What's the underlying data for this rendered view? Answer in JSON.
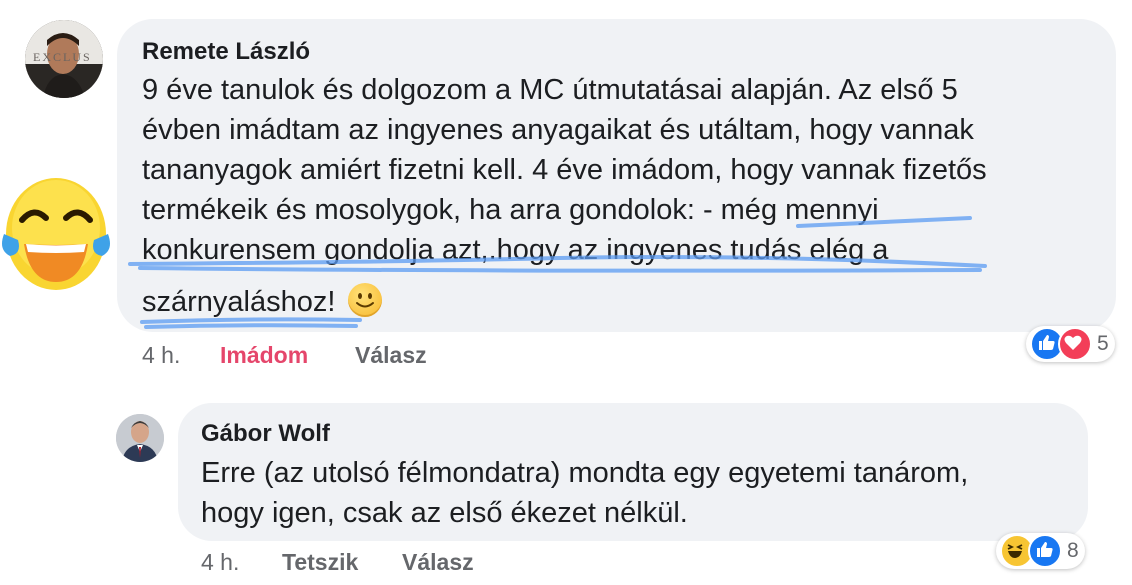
{
  "comments": [
    {
      "author": "Remete László",
      "lines": [
        "9 éve tanulok és dolgozom a MC útmutatásai alapján. Az első 5",
        "évben imádtam az ingyenes anyagaikat és utáltam, hogy vannak",
        "tananyagok amiért fizetni kell. 4 éve imádom, hogy vannak fizetős",
        "termékeik és mosolygok, ha arra gondolok: - még mennyi",
        "konkurensem gondolja azt,.hogy az ingyenes tudás elég a",
        "szárnyaláshoz!"
      ],
      "time": "4 h.",
      "reaction_label": "Imádom",
      "reply_label": "Válasz",
      "reaction_count": "5",
      "reaction_types": [
        "like-icon",
        "love-icon"
      ]
    },
    {
      "author": "Gábor Wolf",
      "lines": [
        "Erre (az utolsó félmondatra) mondta egy egyetemi tanárom,",
        "hogy igen, csak az első ékezet nélkül."
      ],
      "time": "4 h.",
      "reaction_label": "Tetszik",
      "reply_label": "Válasz",
      "reaction_count": "8",
      "reaction_types": [
        "haha-icon",
        "like-icon"
      ]
    }
  ],
  "avatar_1_logo_text": "EXCLUS",
  "colors": {
    "bubble": "#f0f2f5",
    "love_active": "#e5466b",
    "like_blue": "#1877f2",
    "ink_underline": "#5b9bf2"
  }
}
